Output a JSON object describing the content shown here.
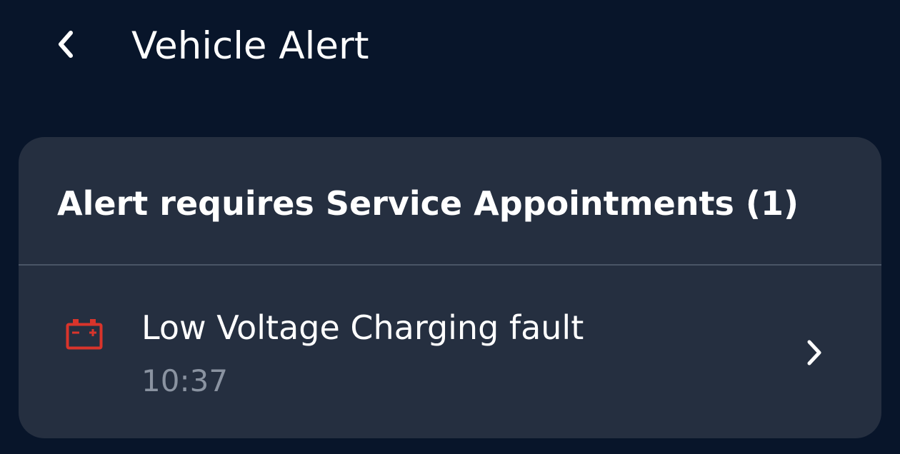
{
  "header": {
    "title": "Vehicle Alert",
    "back_icon": "chevron-left-icon"
  },
  "card": {
    "title": "Alert requires Service Appointments (1)",
    "alerts": [
      {
        "icon": "battery-icon",
        "icon_color": "#d9342b",
        "name": "Low Voltage Charging fault",
        "time": "10:37",
        "chevron_icon": "chevron-right-icon"
      }
    ]
  },
  "colors": {
    "background": "#08152a",
    "card": "#252f40",
    "divider": "#4a5566",
    "text_primary": "#ffffff",
    "text_secondary": "#8a93a1",
    "alert_red": "#d9342b"
  }
}
